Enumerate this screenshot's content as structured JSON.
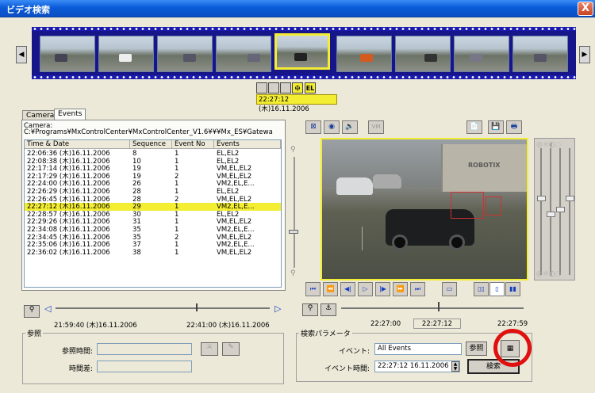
{
  "window": {
    "title": "ビデオ検索",
    "close_label": "X"
  },
  "filmstrip": {
    "prev_label": "◀",
    "next_label": "▶",
    "thumbnail_count": 9,
    "selected_index": 4
  },
  "event_markers": {
    "marker_labels": [
      "",
      "",
      "",
      "",
      "EL"
    ],
    "time": "22:27:12 (木)16.11.2006"
  },
  "tabs": [
    "Cameras",
    "Events"
  ],
  "events": {
    "camera_label": "Camera:",
    "camera_path": "C:¥Programs¥MxControlCenter¥MxControlCenter_V1.6¥¥¥Mx_ES¥Gatewa",
    "columns": [
      "Time & Date",
      "Sequence",
      "Event No",
      "Events"
    ],
    "rows": [
      [
        "22:06:36 (木)16.11.2006",
        "8",
        "1",
        "EL,EL2"
      ],
      [
        "22:08:38 (木)16.11.2006",
        "10",
        "1",
        "EL,EL2"
      ],
      [
        "22:17:14 (木)16.11.2006",
        "19",
        "1",
        "VM,EL,EL2"
      ],
      [
        "22:17:29 (木)16.11.2006",
        "19",
        "2",
        "VM,EL,EL2"
      ],
      [
        "22:24:00 (木)16.11.2006",
        "26",
        "1",
        "VM2,EL,E..."
      ],
      [
        "22:26:29 (木)16.11.2006",
        "28",
        "1",
        "EL,EL2"
      ],
      [
        "22:26:45 (木)16.11.2006",
        "28",
        "2",
        "VM,EL,EL2"
      ],
      [
        "22:27:12 (木)16.11.2006",
        "29",
        "1",
        "VM2,EL,E..."
      ],
      [
        "22:28:57 (木)16.11.2006",
        "30",
        "1",
        "EL,EL2"
      ],
      [
        "22:29:26 (木)16.11.2006",
        "31",
        "1",
        "VM,EL,EL2"
      ],
      [
        "22:34:08 (木)16.11.2006",
        "35",
        "1",
        "VM2,EL,E..."
      ],
      [
        "22:34:45 (木)16.11.2006",
        "35",
        "2",
        "VM,EL,EL2"
      ],
      [
        "22:35:06 (木)16.11.2006",
        "37",
        "1",
        "VM2,EL,E..."
      ],
      [
        "22:36:02 (木)16.11.2006",
        "38",
        "1",
        "VM,EL,EL2"
      ]
    ],
    "selected_row": 7
  },
  "video": {
    "watermark": "ROBOTIX",
    "vm_label": "VM"
  },
  "timeline_left": {
    "start": "21:59:40 (木)16.11.2006",
    "end": "22:41:00 (木)16.11.2006"
  },
  "timeline_right": {
    "start": "22:27:00",
    "current": "22:27:12",
    "end": "22:27:59"
  },
  "reference": {
    "group_title": "参照",
    "ref_time_label": "参照時間:",
    "ref_time_value": "",
    "time_diff_label": "時間差:",
    "time_diff_value": ""
  },
  "search": {
    "group_title": "検索パラメータ",
    "event_label": "イベント:",
    "event_value": "All Events",
    "browse_label": "参照",
    "event_time_label": "イベント時間:",
    "event_time_value": "22:27:12 16.11.2006",
    "search_label": "検索"
  },
  "colors": {
    "highlight": "#f4ee33",
    "annotation_circle": "#e01010",
    "titlebar": "#0a5bd8"
  }
}
